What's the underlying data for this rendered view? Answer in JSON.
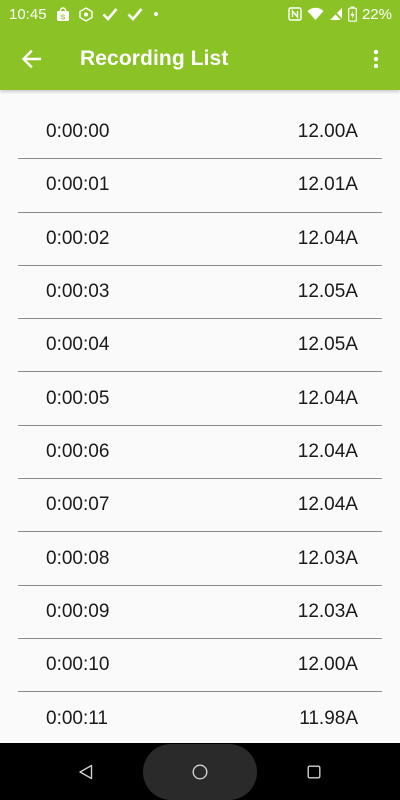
{
  "status_bar": {
    "time": "10:45",
    "battery": "22%",
    "left_icons": [
      "shopping-bag-icon",
      "shield-icon",
      "check-icon",
      "check-icon",
      "dot-icon"
    ],
    "right_icons": [
      "nfc-icon",
      "wifi-icon",
      "no-signal-icon",
      "battery-charging-icon"
    ]
  },
  "app_bar": {
    "title": "Recording List",
    "color": "#8bc326"
  },
  "recordings": [
    {
      "time": "0:00:00",
      "current": "12.00A"
    },
    {
      "time": "0:00:01",
      "current": "12.01A"
    },
    {
      "time": "0:00:02",
      "current": "12.04A"
    },
    {
      "time": "0:00:03",
      "current": "12.05A"
    },
    {
      "time": "0:00:04",
      "current": "12.05A"
    },
    {
      "time": "0:00:05",
      "current": "12.04A"
    },
    {
      "time": "0:00:06",
      "current": "12.04A"
    },
    {
      "time": "0:00:07",
      "current": "12.04A"
    },
    {
      "time": "0:00:08",
      "current": "12.03A"
    },
    {
      "time": "0:00:09",
      "current": "12.03A"
    },
    {
      "time": "0:00:10",
      "current": "12.00A"
    },
    {
      "time": "0:00:11",
      "current": "11.98A"
    }
  ],
  "nav_bar": {
    "buttons": [
      "back-icon",
      "home-icon",
      "recents-icon"
    ]
  }
}
